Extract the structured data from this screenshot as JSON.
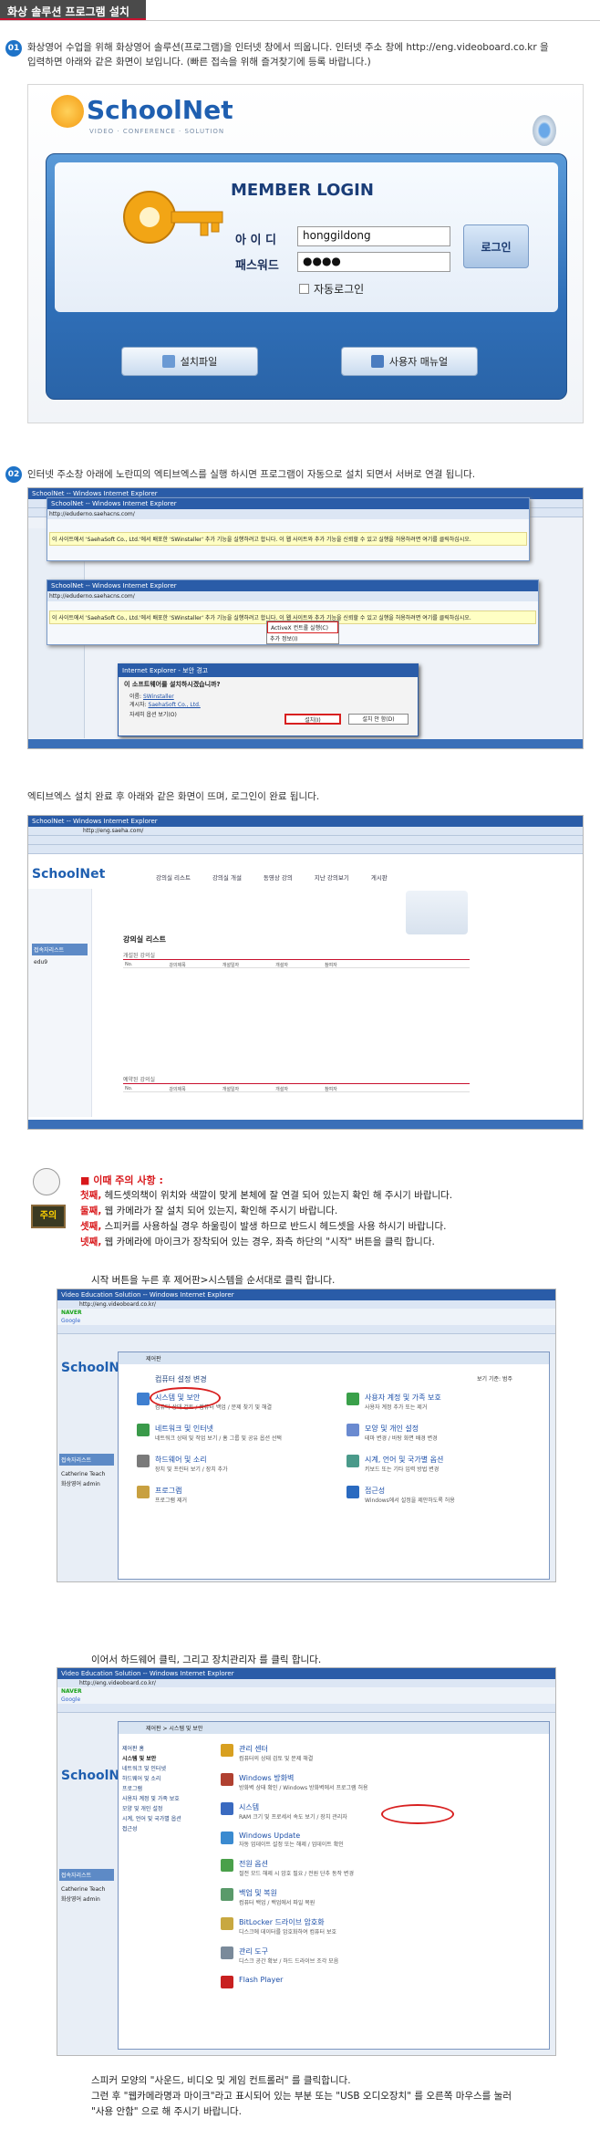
{
  "page_title": "화상 솔루션 프로그램 설치",
  "step1": {
    "num": "01",
    "text_line1": "화상영어 수업을 위해 화상영어 솔루션(프로그램)을 인터넷 창에서 띄웁니다. 인터넷 주소 창에 http://eng.videoboard.co.kr 을",
    "text_line2": "입력하면 아래와 같은 화면이 보입니다. (빠른 접속을 위해 즐겨찾기에 등록 바랍니다.)"
  },
  "login": {
    "logo": "SchoolNet",
    "logo_sub": "VIDEO · CONFERENCE · SOLUTION",
    "heading": "MEMBER LOGIN",
    "id_label": "아 이 디",
    "id_value": "honggildong",
    "pw_label": "패스워드",
    "pw_value": "●●●●",
    "login_button": "로그인",
    "autologin": "자동로그인",
    "install_button": "설치파일",
    "manual_button": "사용자 매뉴얼"
  },
  "step2": {
    "num": "02",
    "text": "인터넷 주소창 아래에 노란띠의 엑티브엑스를 실행 하시면 프로그램이 자동으로 설치 되면서 서버로 연결 됩니다."
  },
  "shot2": {
    "window_title": "SchoolNet -- Windows Internet Explorer",
    "url": "http://eduderno.saehacns.com/",
    "infobar": "이 사이트에서 'SaehaSoft Co., Ltd.'에서 배포한 'SWinstaller' 추가 기능을 실행하려고 합니다. 이 웹 사이트와 추가 기능을 신뢰할 수 있고 실행을 허용하려면 여기를 클릭하십시오.",
    "menu_run": "ActiveX 컨트롤 실행(C)",
    "menu_info": "추가 정보(I)",
    "dialog_title": "Internet Explorer - 보안 경고",
    "dialog_q": "이 소프트웨어를 설치하시겠습니까?",
    "dialog_name_label": "이름:",
    "dialog_name": "SWinstaller",
    "dialog_pub_label": "게시자:",
    "dialog_pub": "SaehaSoft Co., Ltd.",
    "dialog_more": "자세히 옵션 보기(O)",
    "dialog_install": "설치(I)",
    "dialog_cancel": "설치 안 함(D)"
  },
  "text3": "엑티브엑스 설치 완료 후 아래와 같은 화면이 뜨며, 로그인이 완료 됩니다.",
  "shot3": {
    "window_title": "SchoolNet -- Windows Internet Explorer",
    "url": "http://eng.saeha.com/",
    "nav": [
      "강의실 리스트",
      "강의실 개설",
      "동영상 강의",
      "지난 강의보기",
      "게시판"
    ],
    "list_title": "강의실 리스트",
    "open_section": "개설된 강의실",
    "cols": [
      "No.",
      "강의제목",
      "개설일자",
      "개설자",
      "참여자"
    ],
    "reserved_section": "예약된 강의실",
    "side_title": "접속자리스트",
    "side_user": "edu9"
  },
  "warning": {
    "label": "주의",
    "heading": "이때 주의 사항 :",
    "items": [
      {
        "n": "첫째,",
        "t": " 헤드셋의책이 위치와 색깔이 맞게 본체에 잘 연결 되어 있는지 확인 해 주시기 바랍니다."
      },
      {
        "n": "둘째,",
        "t": " 웹 카메라가 잘 설치 되어 있는지, 확인해 주시기 바랍니다."
      },
      {
        "n": "셋째,",
        "t": " 스피커를 사용하실 경우 하울링이 발생 하므로 반드시 헤드셋을 사용 하시기 바랍니다."
      },
      {
        "n": "넷째,",
        "t": " 웹 카메라에 마이크가 장착되어 있는 경우, 좌측 하단의 \"시작\" 버튼을 클릭 합니다."
      }
    ]
  },
  "caption4": "시작 버튼을 누른 후 제어판>시스템을 순서대로 클릭 합니다.",
  "shot4": {
    "window_title": "Video Education Solution -- Windows Internet Explorer",
    "url": "http://eng.videoboard.co.kr/",
    "naver": "NAVER",
    "google": "Google",
    "cp_path": "제어판",
    "cp_heading": "컴퓨터 설정 변경",
    "view_label": "보기 기준: 범주",
    "left_items": [
      {
        "t": "시스템 및 보안",
        "s": "컴퓨터 상태 검토 / 컴퓨터 백업 / 문제 찾기 및 해결"
      },
      {
        "t": "네트워크 및 인터넷",
        "s": "네트워크 상태 및 작업 보기 / 홈 그룹 및 공유 옵션 선택"
      },
      {
        "t": "하드웨어 및 소리",
        "s": "장치 및 프린터 보기 / 장치 추가"
      },
      {
        "t": "프로그램",
        "s": "프로그램 제거"
      }
    ],
    "right_items": [
      {
        "t": "사용자 계정 및 가족 보호",
        "s": "사용자 계정 추가 또는 제거"
      },
      {
        "t": "모양 및 개인 설정",
        "s": "테마 변경 / 바탕 화면 배경 변경"
      },
      {
        "t": "시계, 언어 및 국가별 옵션",
        "s": "키보드 또는 기타 입력 방법 변경"
      },
      {
        "t": "접근성",
        "s": "Windows에서 설정을 제안하도록 허용"
      }
    ],
    "side_title": "접속자리스트",
    "side_user1": "Catherine Teach",
    "side_user2": "화상영어 admin"
  },
  "caption5": "이어서 하드웨어 클릭, 그리고 장치관리자 를 클릭 합니다.",
  "shot5": {
    "window_title": "Video Education Solution -- Windows Internet Explorer",
    "url": "http://eng.videoboard.co.kr/",
    "cp_path": "제어판 > 시스템 및 보안",
    "left_nav": [
      "제어판 홈",
      "시스템 및 보안",
      "네트워크 및 인터넷",
      "하드웨어 및 소리",
      "프로그램",
      "사용자 계정 및 가족 보호",
      "모양 및 개인 설정",
      "시계, 언어 및 국가별 옵션",
      "접근성"
    ],
    "items": [
      {
        "t": "관리 센터",
        "s": "컴퓨터의 상태 검토 및 문제 해결"
      },
      {
        "t": "Windows 방화벽",
        "s": "방화벽 상태 확인 / Windows 방화벽에서 프로그램 허용"
      },
      {
        "t": "시스템",
        "s": "RAM 크기 및 프로세서 속도 보기 / 장치 관리자"
      },
      {
        "t": "Windows Update",
        "s": "자동 업데이트 설정 또는 해제 / 업데이트 확인"
      },
      {
        "t": "전원 옵션",
        "s": "절전 모드 해제 시 암호 필요 / 전원 단추 동작 변경"
      },
      {
        "t": "백업 및 복원",
        "s": "컴퓨터 백업 / 백업에서 파일 복원"
      },
      {
        "t": "BitLocker 드라이브 암호화",
        "s": "디스크에 데이터를 암호화하여 컴퓨터 보호"
      },
      {
        "t": "관리 도구",
        "s": "디스크 공간 확보 / 하드 드라이브 조각 모음"
      },
      {
        "t": "Flash Player",
        "s": ""
      }
    ],
    "side_title": "접속자리스트",
    "side_user1": "Catherine Teach",
    "side_user2": "화상영어 admin"
  },
  "final": {
    "line1": "스피커 모양의 \"사운드, 비디오 및 게임 컨트롤러\" 를 클릭합니다.",
    "line2": "그런 후 \"웹카메라명과 마이크\"라고 표시되어 있는 부분 또는 \"USB 오디오장치\" 를 오른쪽 마우스를 눌러",
    "line3": "\"사용 안함\" 으로 해 주시기 바랍니다."
  }
}
